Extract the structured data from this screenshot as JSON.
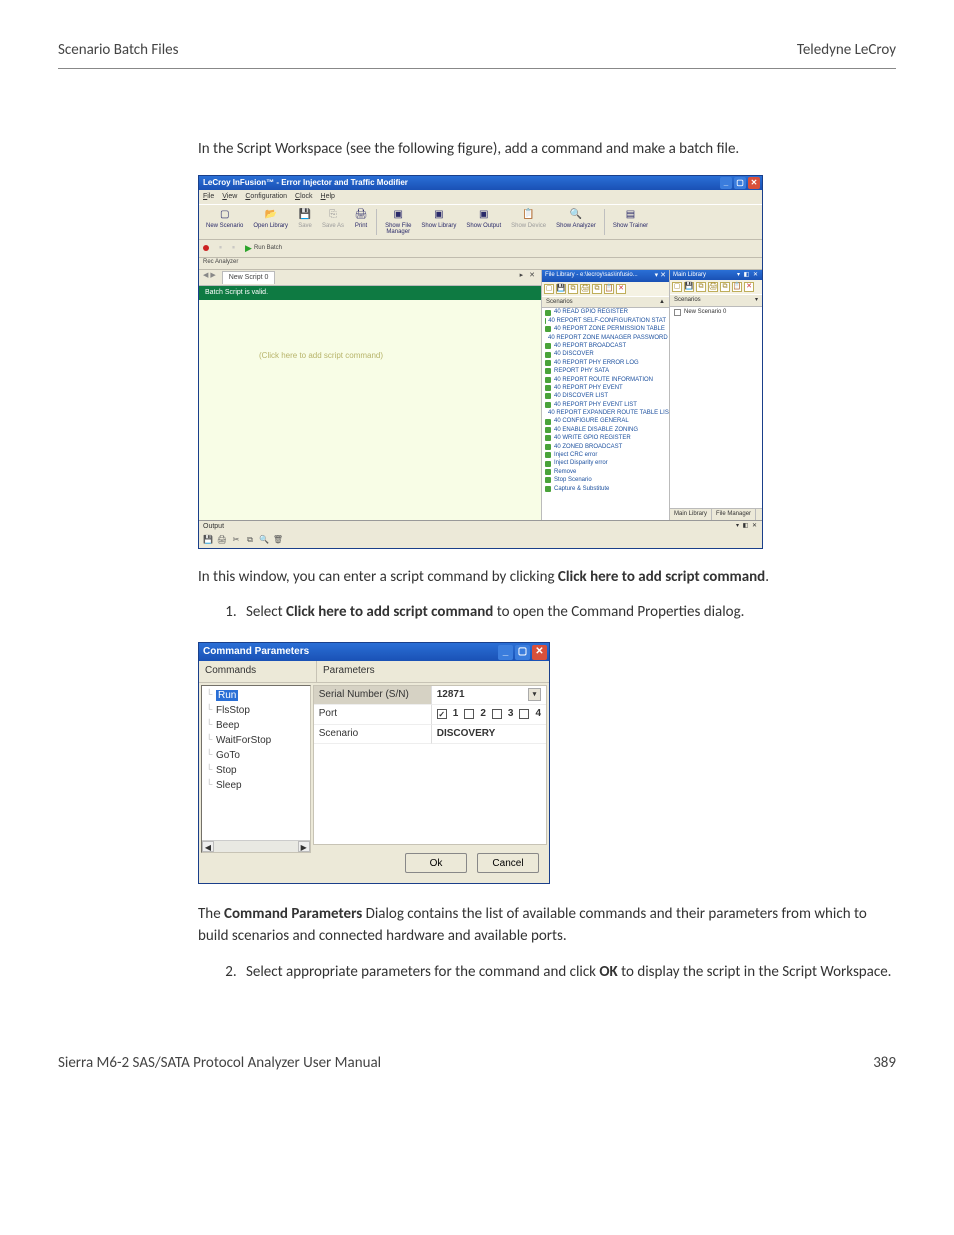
{
  "header": {
    "left": "Scenario Batch Files",
    "right": "Teledyne LeCroy"
  },
  "footer": {
    "left": "Sierra M6-2 SAS/SATA Protocol Analyzer User Manual",
    "right": "389"
  },
  "intro_text": "In the Script Workspace (see the following figure), add a command and make a batch file.",
  "after_shot1_a": "In this window, you can enter a script command by clicking ",
  "after_shot1_b": "Click here to add script command",
  "after_shot1_c": ".",
  "step1_a": "Select ",
  "step1_b": "Click here to add script command",
  "step1_c": " to open the Command Properties dialog.",
  "after_shot2_a": "The ",
  "after_shot2_b": "Command Parameters",
  "after_shot2_c": " Dialog contains the list of available commands and their parameters from which to build scenarios and connected hardware and available ports.",
  "step2_a": "Select appropriate parameters for the command and click ",
  "step2_b": "OK",
  "step2_c": " to display the script in the Script Workspace.",
  "win1": {
    "title": "LeCroy InFusion™ - Error Injector and Traffic Modifier",
    "menu": [
      "File",
      "View",
      "Configuration",
      "Clock",
      "Help"
    ],
    "toolbar": [
      {
        "label": "New Scenario",
        "icon": "▢"
      },
      {
        "label": "Open Library",
        "icon": "📂"
      },
      {
        "label": "Save",
        "icon": "💾",
        "disabled": true
      },
      {
        "label": "Save As",
        "icon": "⎘",
        "disabled": true
      },
      {
        "label": "Print",
        "icon": "🖨"
      },
      {
        "label": "Show File\nManager",
        "icon": "▣"
      },
      {
        "label": "Show Library",
        "icon": "▣"
      },
      {
        "label": "Show Output",
        "icon": "▣"
      },
      {
        "label": "Show Device",
        "icon": "📋",
        "disabled": true
      },
      {
        "label": "Show Analyzer",
        "icon": "🔍"
      },
      {
        "label": "Show Trainer",
        "icon": "▤"
      }
    ],
    "sub_toolbar": {
      "rec": "Rec Analyzer",
      "run": "Run Batch"
    },
    "tab": "New Script 0",
    "valid_msg": "Batch Script is valid.",
    "placeholder": "(Click here to add script command)",
    "filelib_title": "File Library - e:\\lecroy\\sas\\infusio...",
    "filelib_col": "Scenarios",
    "scenarios": [
      "40 READ GPIO REGISTER",
      "40 REPORT SELF-CONFIGURATION STAT",
      "40 REPORT ZONE PERMISSION TABLE",
      "40 REPORT ZONE MANAGER PASSWORD",
      "40 REPORT BROADCAST",
      "40 DISCOVER",
      "40 REPORT PHY ERROR LOG",
      "REPORT PHY SATA",
      "40 REPORT ROUTE INFORMATION",
      "40 REPORT PHY EVENT",
      "40 DISCOVER LIST",
      "40 REPORT PHY EVENT LIST",
      "40 REPORT EXPANDER ROUTE TABLE LIS",
      "40 CONFIGURE GENERAL",
      "40 ENABLE DISABLE ZONING",
      "40 WRITE GPIO REGISTER",
      "40 ZONED BROADCAST",
      "Inject CRC error",
      "Inject Disparity error",
      "Remove",
      "Stop Scenario",
      "Capture & Substitute"
    ],
    "mainlib_title": "Main Library",
    "mainlib_col": "Scenarios",
    "mainlib_item": "New Scenario 0",
    "bottom_tabs": [
      "Main Library",
      "File Manager"
    ],
    "output_label": "Output"
  },
  "win2": {
    "title": "Command Parameters",
    "commands_header": "Commands",
    "params_header": "Parameters",
    "commands": [
      "Run",
      "FlsStop",
      "Beep",
      "WaitForStop",
      "GoTo",
      "Stop",
      "Sleep"
    ],
    "selected_command": "Run",
    "params": {
      "serial_label": "Serial Number (S/N)",
      "serial_value": "12871",
      "port_label": "Port",
      "port_options": [
        "1",
        "2",
        "3",
        "4"
      ],
      "port_checked": [
        true,
        false,
        false,
        false
      ],
      "scenario_label": "Scenario",
      "scenario_value": "DISCOVERY"
    },
    "buttons": {
      "ok": "Ok",
      "cancel": "Cancel"
    }
  },
  "chart_data": {
    "type": "table",
    "title": "Command Parameters — Run",
    "rows": [
      {
        "parameter": "Serial Number (S/N)",
        "value": "12871"
      },
      {
        "parameter": "Port",
        "value": "1 (checked); 2,3,4 unchecked"
      },
      {
        "parameter": "Scenario",
        "value": "DISCOVERY"
      }
    ]
  }
}
